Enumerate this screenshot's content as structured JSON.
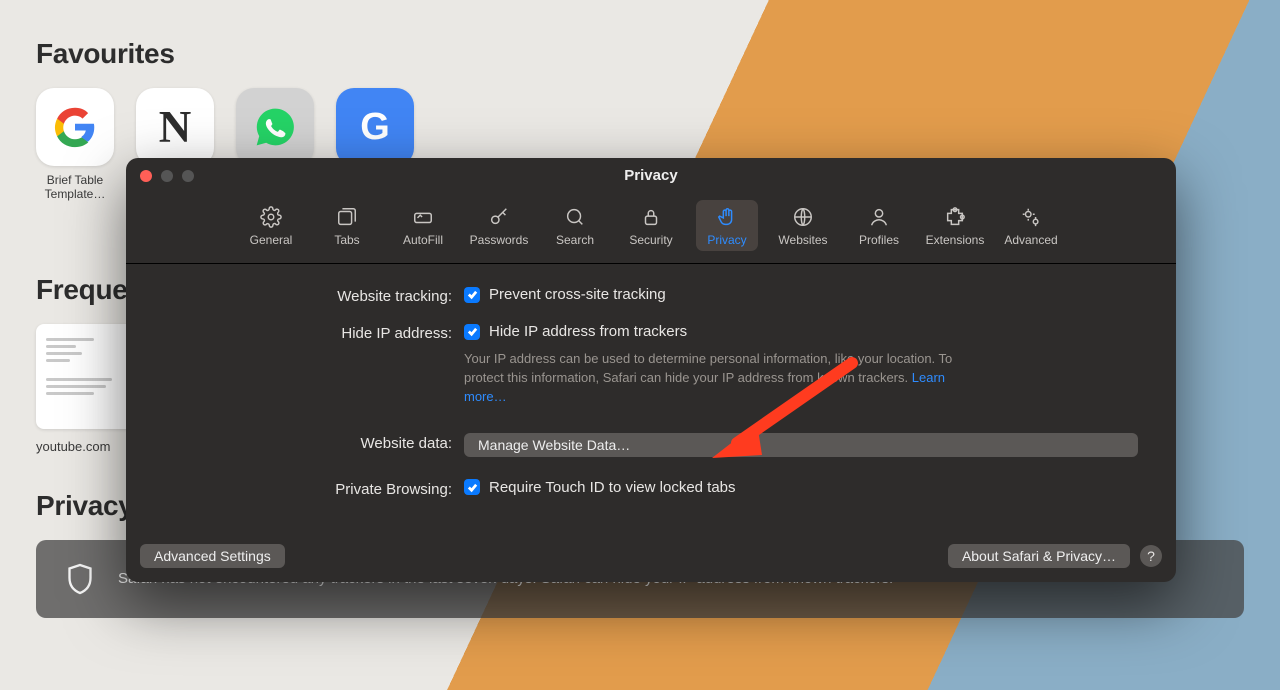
{
  "page": {
    "favourites_heading": "Favourites",
    "favourites": [
      {
        "letter": "G",
        "label": "Brief Table Template…",
        "variant": "google"
      },
      {
        "letter": "N",
        "label": "",
        "variant": "notion"
      },
      {
        "letter": "",
        "label": "",
        "variant": "whatsapp"
      },
      {
        "letter": "G",
        "label": "",
        "variant": "blue"
      }
    ],
    "frequently_heading": "Frequently",
    "frequently_label": "youtube.com",
    "privacy_report_heading": "Privacy Report",
    "privacy_report_text": "Safari has not encountered any trackers in the last seven days. Safari can hide your IP address from known trackers."
  },
  "prefs": {
    "title": "Privacy",
    "tabs": [
      "General",
      "Tabs",
      "AutoFill",
      "Passwords",
      "Search",
      "Security",
      "Privacy",
      "Websites",
      "Profiles",
      "Extensions",
      "Advanced"
    ],
    "active_tab": "Privacy",
    "rows": {
      "tracking_label": "Website tracking:",
      "tracking_check": "Prevent cross-site tracking",
      "hideip_label": "Hide IP address:",
      "hideip_check": "Hide IP address from trackers",
      "hideip_help": "Your IP address can be used to determine personal information, like your location. To protect this information, Safari can hide your IP address from known trackers. ",
      "learn_more": "Learn more…",
      "websitedata_label": "Website data:",
      "manage_btn": "Manage Website Data…",
      "privatebrowsing_label": "Private Browsing:",
      "privatebrowsing_check": "Require Touch ID to view locked tabs"
    },
    "footer": {
      "advanced": "Advanced Settings",
      "about": "About Safari & Privacy…",
      "help": "?"
    }
  }
}
